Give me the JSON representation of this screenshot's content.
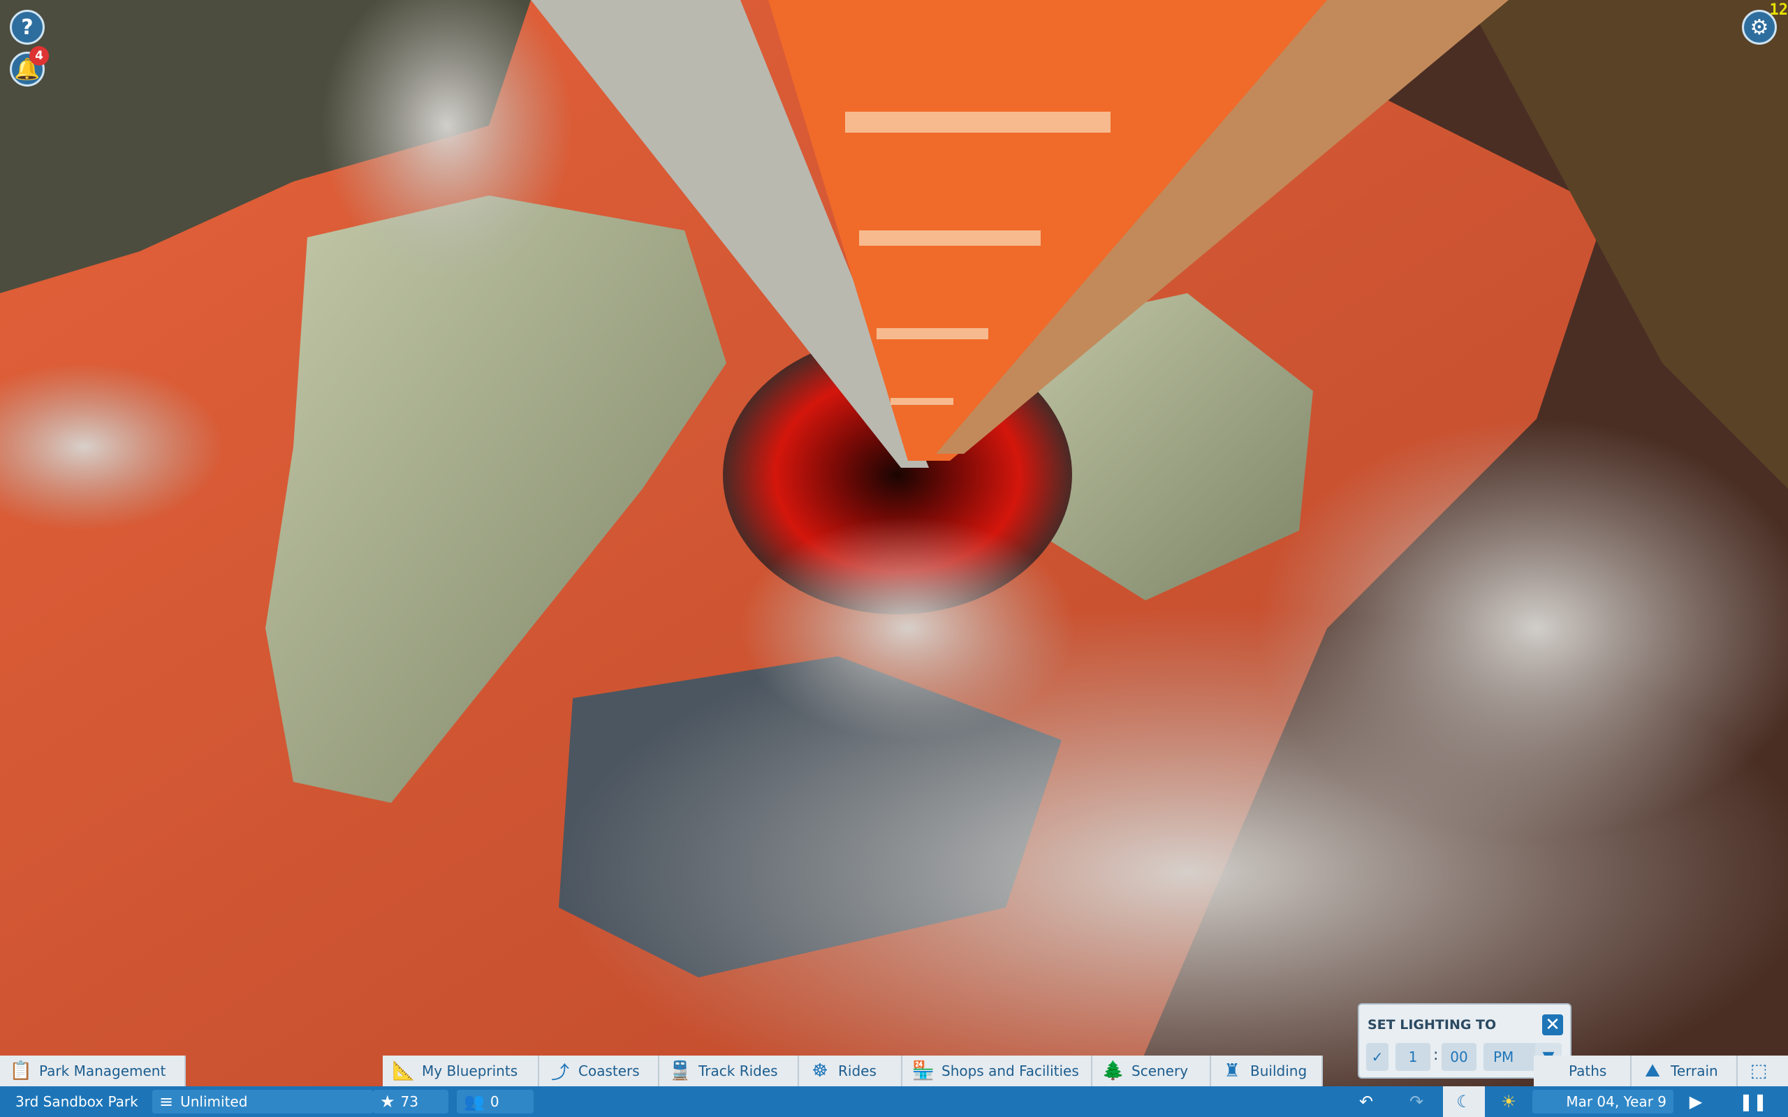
{
  "top_left": {
    "help_icon_glyph": "?",
    "notification_count": "4"
  },
  "corner_readout": "12",
  "lighting_popup": {
    "title": "SET LIGHTING TO",
    "hour": "1",
    "minute": "00",
    "ampm": "PM"
  },
  "toolbar": {
    "park_management": "Park Management",
    "my_blueprints": "My Blueprints",
    "coasters": "Coasters",
    "track_rides": "Track Rides",
    "rides": "Rides",
    "shops_and_facilities": "Shops and Facilities",
    "scenery": "Scenery",
    "building": "Building",
    "paths": "Paths",
    "terrain": "Terrain"
  },
  "status_bar": {
    "park_name": "3rd Sandbox Park",
    "money": "Unlimited",
    "rating": "73",
    "guests": "0",
    "date": "Mar 04, Year 9"
  },
  "colors": {
    "accent": "#1d75b8",
    "toolbar_bg": "#e6ebef",
    "lava_red": "#d4361c",
    "coaster_orange": "#f06a2a"
  }
}
